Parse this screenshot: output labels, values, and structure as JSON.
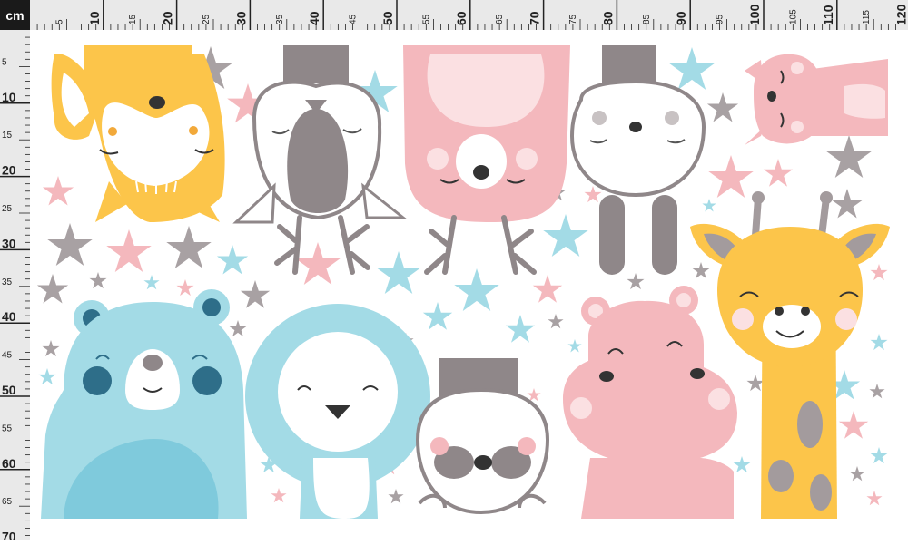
{
  "ruler": {
    "unit": "cm",
    "top_labels": [
      "5",
      "10",
      "15",
      "20",
      "25",
      "30",
      "35",
      "40",
      "45",
      "50",
      "55",
      "60",
      "65",
      "70",
      "75",
      "80",
      "85",
      "90",
      "95",
      "100",
      "105",
      "110",
      "115",
      "120"
    ],
    "left_labels": [
      "5",
      "10",
      "15",
      "20",
      "25",
      "30",
      "35",
      "40",
      "45",
      "50",
      "55",
      "60",
      "65",
      "70"
    ]
  },
  "palette": {
    "yellow": "#fcc54a",
    "pink": "#f4b8bd",
    "blue": "#a3dbe6",
    "gray": "#8f8789",
    "dark_blue": "#2e6e89"
  },
  "illustration": {
    "animals": [
      "fox-icon",
      "owl-icon",
      "bear-pink-icon",
      "bunny-icon",
      "cat-icon",
      "giraffe-icon",
      "bear-blue-icon",
      "lion-icon",
      "raccoon-icon",
      "hippo-icon"
    ],
    "decorations": [
      "star-icon"
    ]
  }
}
